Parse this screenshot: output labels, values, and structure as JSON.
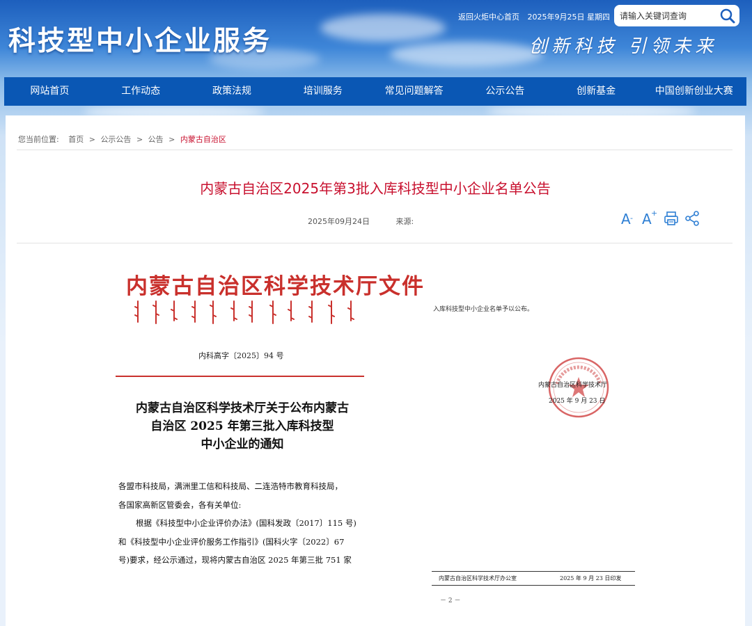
{
  "header": {
    "site_title": "科技型中小企业服务",
    "slogan": "创新科技 引领未来",
    "top_links": {
      "home_link": "返回火炬中心首页",
      "date": "2025年9月25日 星期四"
    },
    "search": {
      "placeholder": "请输入关键词查询",
      "icon": "search-icon"
    }
  },
  "nav": {
    "items": [
      "网站首页",
      "工作动态",
      "政策法规",
      "培训服务",
      "常见问题解答",
      "公示公告",
      "创新基金",
      "中国创新创业大赛"
    ]
  },
  "breadcrumb": {
    "prefix": "您当前位置:",
    "items": [
      "首页",
      "公示公告",
      "公告",
      "内蒙古自治区"
    ],
    "separator": ">"
  },
  "article": {
    "title": "内蒙古自治区2025年第3批入库科技型中小企业名单公告",
    "date": "2025年09月24日",
    "source_label": "来源:",
    "tools": {
      "font_small": "A",
      "font_large": "A",
      "font_large_sup": "+",
      "icons": [
        "font-decrease-icon",
        "font-increase-icon",
        "print-icon",
        "share-icon"
      ]
    }
  },
  "document": {
    "header": "内蒙古自治区科学技术厅文件",
    "number": "内科高字〔2025〕94 号",
    "title_lines": [
      "内蒙古自治区科学技术厅关于公布内蒙古",
      "自治区 2025 年第三批入库科技型",
      "中小企业的通知"
    ],
    "body_lines": [
      "各盟市科技局，满洲里工信和科技局、二连浩特市教育科技局，",
      "各国家高新区管委会，各有关单位:",
      "根据《科技型中小企业评价办法》(国科发政〔2017〕115 号)",
      "和《科技型中小企业评价服务工作指引》(国科火字〔2022〕67",
      "号)要求，经公示通过，现将内蒙古自治区 2025 年第三批 751 家"
    ],
    "right_text": "入库科技型中小企业名单予以公布。",
    "signature_org": "内蒙古自治区科学技术厅",
    "signature_date": "2025 年 9 月 23 日",
    "footer_left": "内蒙古自治区科学技术厅办公室",
    "footer_right": "2025 年 9 月 23 日印发",
    "page_number": "－ 2 －"
  },
  "colors": {
    "nav_bg": "#0a57b4",
    "title_red": "#c8102e",
    "doc_red": "#c9302c",
    "tool_blue": "#2e7fd4"
  }
}
